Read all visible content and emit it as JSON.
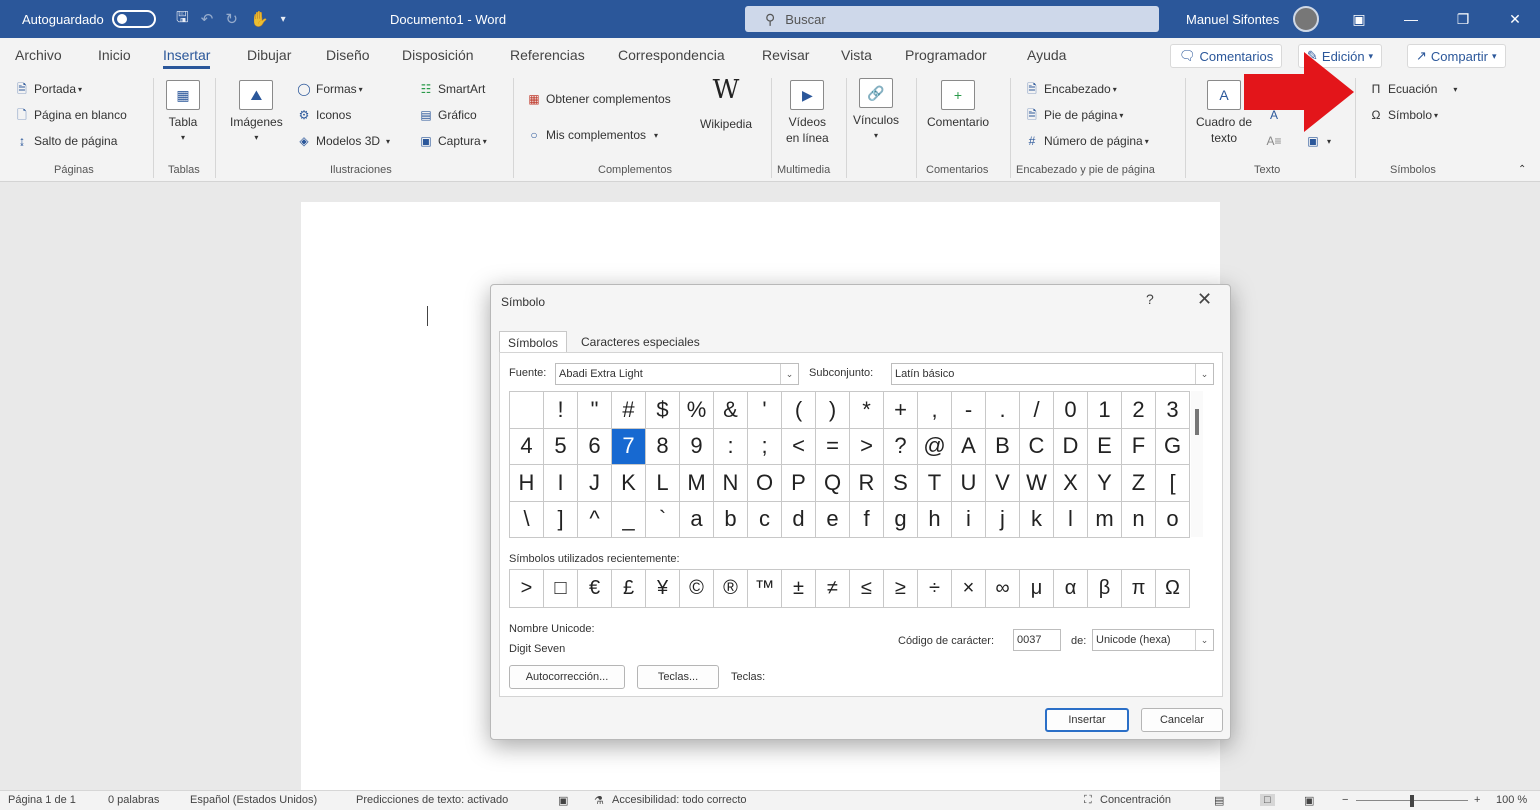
{
  "titlebar": {
    "autosave": "Autoguardado",
    "doc_title": "Documento1  -  Word",
    "search_placeholder": "Buscar",
    "user": "Manuel Sifontes"
  },
  "menu": {
    "tabs": [
      "Archivo",
      "Inicio",
      "Insertar",
      "Dibujar",
      "Diseño",
      "Disposición",
      "Referencias",
      "Correspondencia",
      "Revisar",
      "Vista",
      "Programador",
      "Ayuda"
    ],
    "comentarios": "Comentarios",
    "edicion": "Edición",
    "compartir": "Compartir"
  },
  "ribbon": {
    "paginas": {
      "portada": "Portada",
      "en_blanco": "Página en blanco",
      "salto": "Salto de página",
      "label": "Páginas"
    },
    "tablas": {
      "tabla": "Tabla",
      "label": "Tablas"
    },
    "ilustraciones": {
      "imagenes": "Imágenes",
      "formas": "Formas",
      "iconos": "Iconos",
      "modelos": "Modelos 3D",
      "smartart": "SmartArt",
      "grafico": "Gráfico",
      "captura": "Captura",
      "label": "Ilustraciones"
    },
    "complementos": {
      "obtener": "Obtener complementos",
      "mis": "Mis complementos",
      "wikipedia": "Wikipedia",
      "label": "Complementos"
    },
    "multimedia": {
      "videos1": "Vídeos",
      "videos2": "en línea",
      "label": "Multimedia"
    },
    "vinculos": {
      "vinculos": "Vínculos"
    },
    "comentarios": {
      "comentario": "Comentario",
      "label": "Comentarios"
    },
    "encabezado": {
      "encabezado": "Encabezado",
      "pie": "Pie de página",
      "numero": "Número de página",
      "label": "Encabezado y pie de página"
    },
    "texto": {
      "cuadro1": "Cuadro de",
      "cuadro2": "texto",
      "label": "Texto"
    },
    "simbolos": {
      "ecuacion": "Ecuación",
      "simbolo": "Símbolo",
      "label": "Símbolos"
    }
  },
  "dialog": {
    "title": "Símbolo",
    "help": "?",
    "close": "✕",
    "tab_simbolos": "Símbolos",
    "tab_especiales": "Caracteres especiales",
    "fuente_label": "Fuente:",
    "fuente_value": "Abadi Extra Light",
    "subconjunto_label": "Subconjunto:",
    "subconjunto_value": "Latín básico",
    "symbols": [
      " ",
      "!",
      "\"",
      "#",
      "$",
      "%",
      "&",
      "'",
      "(",
      ")",
      "*",
      "+",
      ",",
      "-",
      ".",
      "/",
      "0",
      "1",
      "2",
      "3",
      "4",
      "5",
      "6",
      "7",
      "8",
      "9",
      ":",
      ";",
      "<",
      "=",
      ">",
      "?",
      "@",
      "A",
      "B",
      "C",
      "D",
      "E",
      "F",
      "G",
      "H",
      "I",
      "J",
      "K",
      "L",
      "M",
      "N",
      "O",
      "P",
      "Q",
      "R",
      "S",
      "T",
      "U",
      "V",
      "W",
      "X",
      "Y",
      "Z",
      "[",
      "\\",
      "]",
      "^",
      "_",
      "`",
      "a",
      "b",
      "c",
      "d",
      "e",
      "f",
      "g",
      "h",
      "i",
      "j",
      "k",
      "l",
      "m",
      "n",
      "o"
    ],
    "selected_symbol": "7",
    "recent_label": "Símbolos utilizados recientemente:",
    "recent": [
      ">",
      "□",
      "€",
      "£",
      "¥",
      "©",
      "®",
      "™",
      "±",
      "≠",
      "≤",
      "≥",
      "÷",
      "×",
      "∞",
      "μ",
      "α",
      "β",
      "π",
      "Ω"
    ],
    "unicode_name_label": "Nombre Unicode:",
    "unicode_name": "Digit Seven",
    "codigo_label": "Código de carácter:",
    "codigo_value": "0037",
    "de_label": "de:",
    "de_value": "Unicode (hexa)",
    "autocorreccion": "Autocorrección...",
    "teclas_btn": "Teclas...",
    "teclas_label": "Teclas:",
    "insertar": "Insertar",
    "cancelar": "Cancelar"
  },
  "status": {
    "pagina": "Página 1 de 1",
    "palabras": "0 palabras",
    "idioma": "Español (Estados Unidos)",
    "predicciones": "Predicciones de texto: activado",
    "accesibilidad": "Accesibilidad: todo correcto",
    "concentracion": "Concentración",
    "zoom": "100 %"
  },
  "colors": {
    "accent": "#2b579a",
    "arrow": "#e3151a",
    "selected": "#1769d1"
  }
}
